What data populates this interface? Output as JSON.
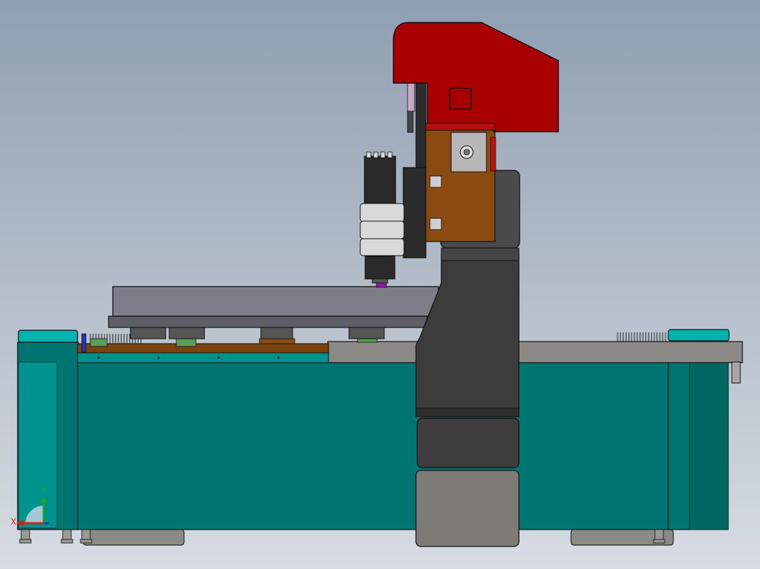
{
  "view": {
    "background_top": "#8f9fb2",
    "background_bottom": "#d7dce3"
  },
  "colors": {
    "base_teal": "#007470",
    "base_teal_light": "#00a6a0",
    "base_teal_edge": "#005a57",
    "head_red": "#a80000",
    "column_dark": "#3a3a3a",
    "column_mid": "#4a4a4a",
    "table_grey": "#7d7e8a",
    "rail_grey": "#8c8a86",
    "carriage_brown": "#8a4a10",
    "spindle_black": "#2a2a2a",
    "bracket_light": "#d9d9d9",
    "tool_purple": "#8c1aa6",
    "gear_green": "#5a9c5a"
  },
  "triad": {
    "x_label": "X",
    "y_label": "Y",
    "x_color": "#d62020",
    "y_color": "#18a43a",
    "z_color": "#1c2fc8"
  },
  "parts": {
    "machine_base": "machine-base",
    "gantry_column": "gantry-column",
    "spindle_head": "spindle-head",
    "work_table": "work-table"
  }
}
